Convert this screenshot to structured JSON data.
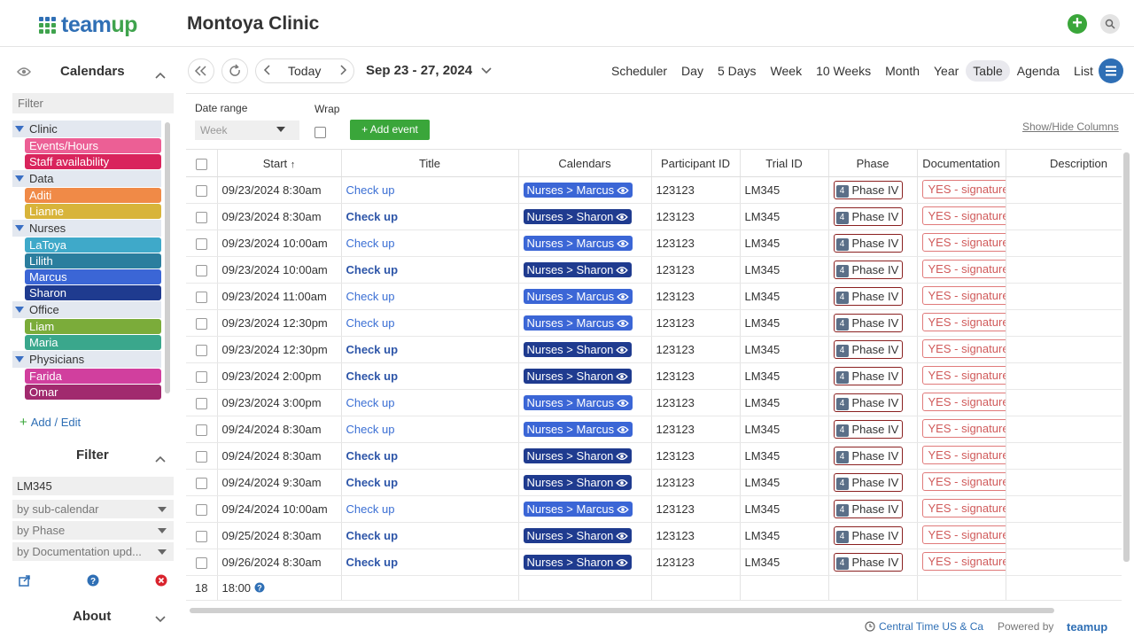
{
  "app": {
    "logo_text_a": "team",
    "logo_text_b": "up",
    "title": "Montoya Clinic"
  },
  "sidebar": {
    "calendars_title": "Calendars",
    "filter_placeholder": "Filter",
    "groups": [
      {
        "name": "Clinic",
        "items": [
          {
            "label": "Events/Hours",
            "color": "#ec5f95"
          },
          {
            "label": "Staff availability",
            "color": "#d9245c"
          }
        ]
      },
      {
        "name": "Data",
        "items": [
          {
            "label": "Aditi",
            "color": "#f08a47"
          },
          {
            "label": "Lianne",
            "color": "#d8b43a"
          }
        ]
      },
      {
        "name": "Nurses",
        "items": [
          {
            "label": "LaToya",
            "color": "#3fa9c9"
          },
          {
            "label": "Lilith",
            "color": "#2b7e9e"
          },
          {
            "label": "Marcus",
            "color": "#3b66d6"
          },
          {
            "label": "Sharon",
            "color": "#1f3b8f"
          }
        ]
      },
      {
        "name": "Office",
        "items": [
          {
            "label": "Liam",
            "color": "#7bac3a"
          },
          {
            "label": "Maria",
            "color": "#3aa78c"
          }
        ]
      },
      {
        "name": "Physicians",
        "items": [
          {
            "label": "Farida",
            "color": "#d13f9e"
          },
          {
            "label": "Omar",
            "color": "#a12a6e"
          }
        ]
      }
    ],
    "add_edit": "Add / Edit",
    "filter_title": "Filter",
    "filter_value": "LM345",
    "filter_dropdowns": [
      "by sub-calendar",
      "by Phase",
      "by Documentation upd..."
    ],
    "about_title": "About"
  },
  "toolbar": {
    "today": "Today",
    "date_range": "Sep 23 - 27, 2024",
    "views": [
      "Scheduler",
      "Day",
      "5 Days",
      "Week",
      "10 Weeks",
      "Month",
      "Year",
      "Table",
      "Agenda",
      "List"
    ],
    "active_view": "Table"
  },
  "controls": {
    "date_range_label": "Date range",
    "date_range_value": "Week",
    "wrap_label": "Wrap",
    "add_event": "+ Add event",
    "show_hide": "Show/Hide Columns"
  },
  "table": {
    "headers": {
      "start": "Start",
      "title": "Title",
      "calendars": "Calendars",
      "participant": "Participant ID",
      "trial": "Trial ID",
      "phase": "Phase",
      "documentation": "Documentation",
      "description": "Description"
    },
    "rows": [
      {
        "start": "09/23/2024 8:30am",
        "title": "Check up",
        "calendar": "Nurses > Marcus",
        "cal_color": "#3b66d6",
        "participant": "123123",
        "trial": "LM345",
        "phase_num": "4",
        "phase": "Phase IV",
        "doc": "YES - signature"
      },
      {
        "start": "09/23/2024 8:30am",
        "title": "Check up",
        "calendar": "Nurses > Sharon",
        "cal_color": "#1f3b8f",
        "participant": "123123",
        "trial": "LM345",
        "phase_num": "4",
        "phase": "Phase IV",
        "doc": "YES - signature"
      },
      {
        "start": "09/23/2024 10:00am",
        "title": "Check up",
        "calendar": "Nurses > Marcus",
        "cal_color": "#3b66d6",
        "participant": "123123",
        "trial": "LM345",
        "phase_num": "4",
        "phase": "Phase IV",
        "doc": "YES - signature"
      },
      {
        "start": "09/23/2024 10:00am",
        "title": "Check up",
        "calendar": "Nurses > Sharon",
        "cal_color": "#1f3b8f",
        "participant": "123123",
        "trial": "LM345",
        "phase_num": "4",
        "phase": "Phase IV",
        "doc": "YES - signature"
      },
      {
        "start": "09/23/2024 11:00am",
        "title": "Check up",
        "calendar": "Nurses > Marcus",
        "cal_color": "#3b66d6",
        "participant": "123123",
        "trial": "LM345",
        "phase_num": "4",
        "phase": "Phase IV",
        "doc": "YES - signature"
      },
      {
        "start": "09/23/2024 12:30pm",
        "title": "Check up",
        "calendar": "Nurses > Marcus",
        "cal_color": "#3b66d6",
        "participant": "123123",
        "trial": "LM345",
        "phase_num": "4",
        "phase": "Phase IV",
        "doc": "YES - signature"
      },
      {
        "start": "09/23/2024 12:30pm",
        "title": "Check up",
        "calendar": "Nurses > Sharon",
        "cal_color": "#1f3b8f",
        "participant": "123123",
        "trial": "LM345",
        "phase_num": "4",
        "phase": "Phase IV",
        "doc": "YES - signature"
      },
      {
        "start": "09/23/2024 2:00pm",
        "title": "Check up",
        "calendar": "Nurses > Sharon",
        "cal_color": "#1f3b8f",
        "participant": "123123",
        "trial": "LM345",
        "phase_num": "4",
        "phase": "Phase IV",
        "doc": "YES - signature"
      },
      {
        "start": "09/23/2024 3:00pm",
        "title": "Check up",
        "calendar": "Nurses > Marcus",
        "cal_color": "#3b66d6",
        "participant": "123123",
        "trial": "LM345",
        "phase_num": "4",
        "phase": "Phase IV",
        "doc": "YES - signature"
      },
      {
        "start": "09/24/2024 8:30am",
        "title": "Check up",
        "calendar": "Nurses > Marcus",
        "cal_color": "#3b66d6",
        "participant": "123123",
        "trial": "LM345",
        "phase_num": "4",
        "phase": "Phase IV",
        "doc": "YES - signature"
      },
      {
        "start": "09/24/2024 8:30am",
        "title": "Check up",
        "calendar": "Nurses > Sharon",
        "cal_color": "#1f3b8f",
        "participant": "123123",
        "trial": "LM345",
        "phase_num": "4",
        "phase": "Phase IV",
        "doc": "YES - signature"
      },
      {
        "start": "09/24/2024 9:30am",
        "title": "Check up",
        "calendar": "Nurses > Sharon",
        "cal_color": "#1f3b8f",
        "participant": "123123",
        "trial": "LM345",
        "phase_num": "4",
        "phase": "Phase IV",
        "doc": "YES - signature"
      },
      {
        "start": "09/24/2024 10:00am",
        "title": "Check up",
        "calendar": "Nurses > Marcus",
        "cal_color": "#3b66d6",
        "participant": "123123",
        "trial": "LM345",
        "phase_num": "4",
        "phase": "Phase IV",
        "doc": "YES - signature"
      },
      {
        "start": "09/25/2024 8:30am",
        "title": "Check up",
        "calendar": "Nurses > Sharon",
        "cal_color": "#1f3b8f",
        "participant": "123123",
        "trial": "LM345",
        "phase_num": "4",
        "phase": "Phase IV",
        "doc": "YES - signature"
      },
      {
        "start": "09/26/2024 8:30am",
        "title": "Check up",
        "calendar": "Nurses > Sharon",
        "cal_color": "#1f3b8f",
        "participant": "123123",
        "trial": "LM345",
        "phase_num": "4",
        "phase": "Phase IV",
        "doc": "YES - signature"
      }
    ],
    "footer_count": "18",
    "footer_duration": "18:00"
  },
  "footer": {
    "timezone": "Central Time US & Ca",
    "powered_by": "Powered by",
    "brand": "teamup"
  }
}
